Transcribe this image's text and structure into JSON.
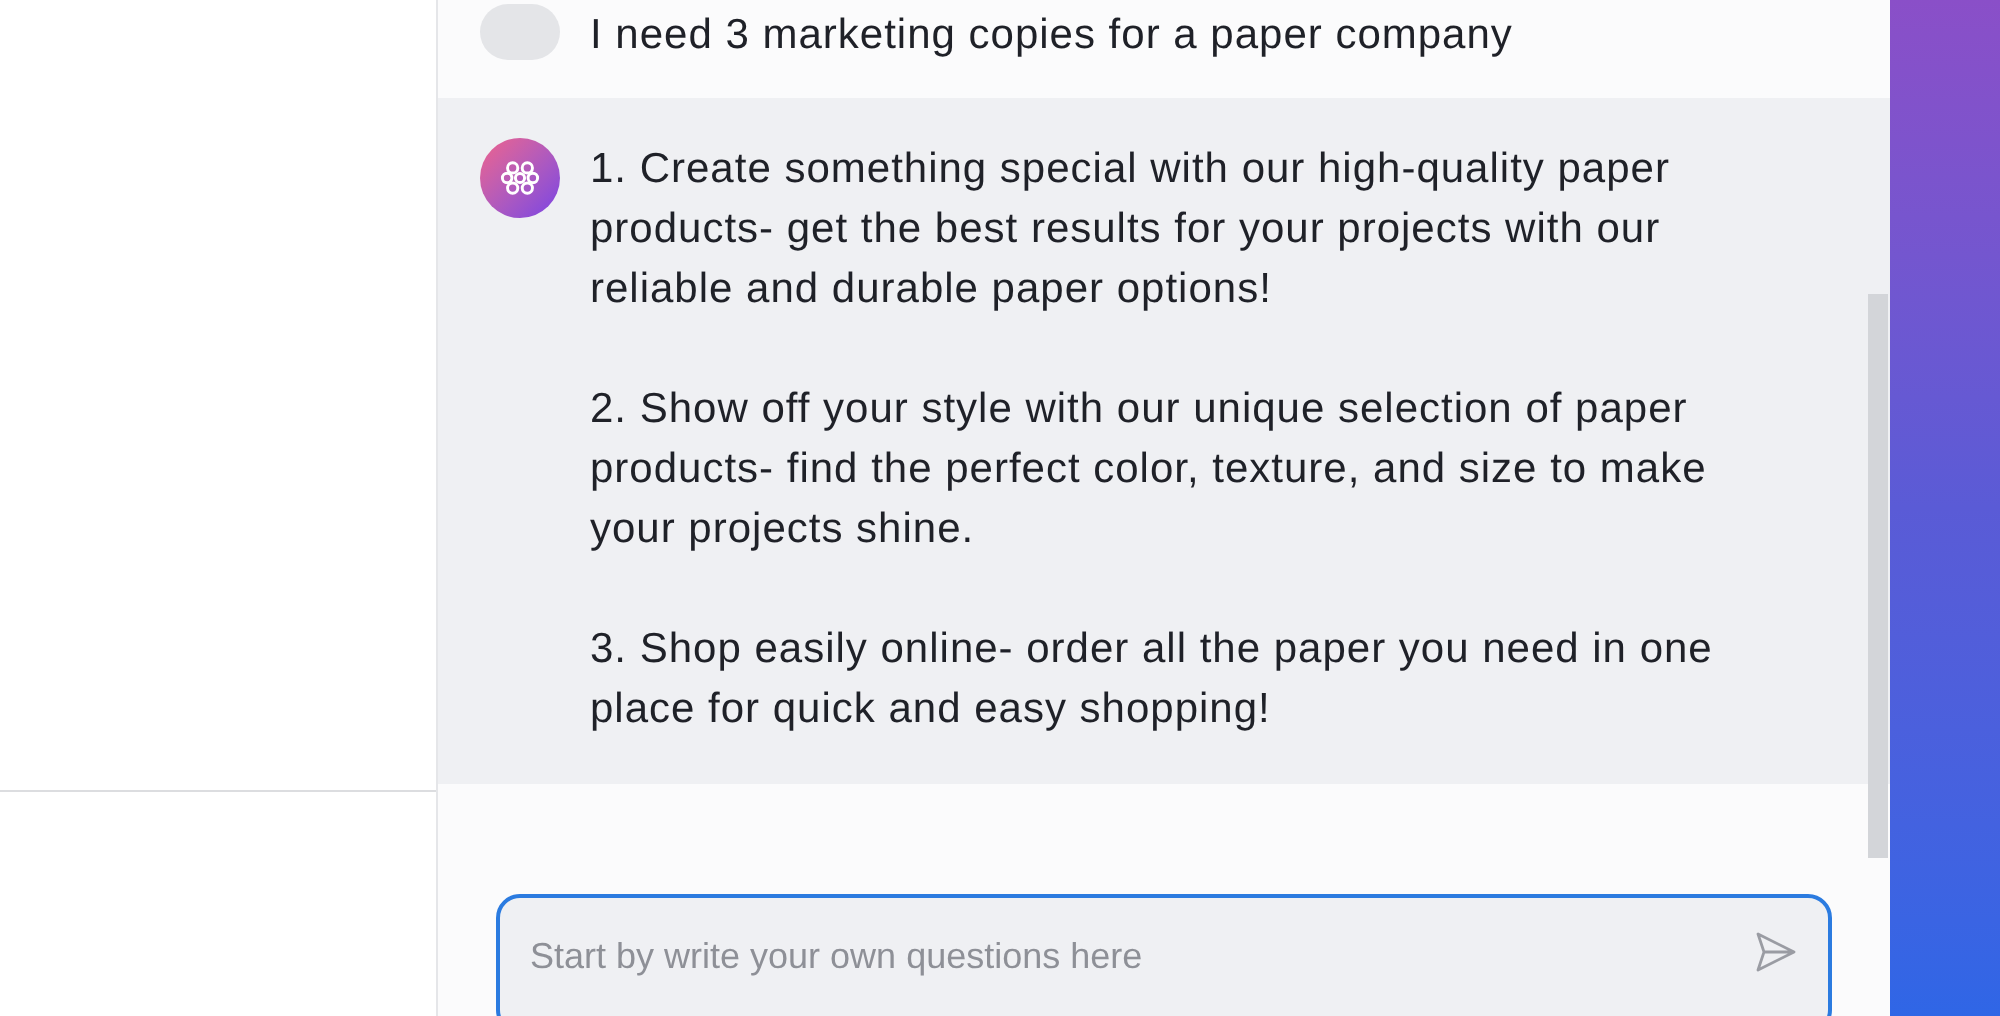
{
  "conversation": [
    {
      "kind": "user",
      "paragraphs": [
        "I need 3 marketing copies for a paper company"
      ]
    },
    {
      "kind": "assistant",
      "paragraphs": [
        "1. Create something special with our high-quality paper products- get the best results for your projects with our reliable and durable paper options!",
        "2. Show off your style with our unique selection of paper products- find the perfect color, texture, and size to make your projects shine.",
        "3. Shop easily online- order all the paper you need in one place for quick and easy shopping!"
      ]
    }
  ],
  "composer": {
    "placeholder": "Start by write your own questions here"
  }
}
